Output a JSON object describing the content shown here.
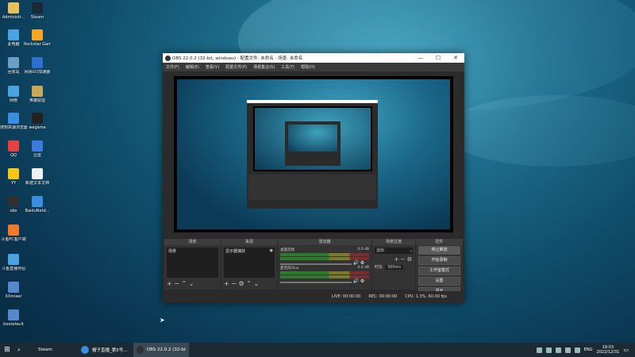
{
  "desktop": {
    "icons": [
      {
        "label": "Administr...",
        "color": "#e8c15a"
      },
      {
        "label": "Steam",
        "color": "#1b2838"
      },
      {
        "label": "此电脑",
        "color": "#4aa3e0"
      },
      {
        "label": "Rockstar Games...",
        "color": "#f5a623"
      },
      {
        "label": "回收站",
        "color": "#6aa0c8"
      },
      {
        "label": "网易UU加速器",
        "color": "#2f6fd0"
      },
      {
        "label": "网络",
        "color": "#4aa3e0"
      },
      {
        "label": "英雄联盟",
        "color": "#c8a85a"
      },
      {
        "label": "搜狗高速浏览器",
        "color": "#3b8de0"
      },
      {
        "label": "wegame",
        "color": "#222222"
      },
      {
        "label": "QQ",
        "color": "#e84040"
      },
      {
        "label": "迅雷",
        "color": "#3b7be0"
      },
      {
        "label": "YY",
        "color": "#f5c518"
      },
      {
        "label": "新建文本文档",
        "color": "#f0f0f0"
      },
      {
        "label": "obs",
        "color": "#303030"
      },
      {
        "label": "BaiduNetd...",
        "color": "#3b8de0"
      },
      {
        "label": "斗鱼PC客户端",
        "color": "#f07a2a"
      },
      {
        "label": "斗鱼直播伴侣",
        "color": "#4aa3e0"
      },
      {
        "label": "XXmixer",
        "color": "#5588cc"
      },
      {
        "label": "bootefault",
        "color": "#5588cc"
      }
    ]
  },
  "obs": {
    "title": "OBS 22.0.2 (32-bit, windows) - 配置文件: 未命名 - 场景: 未命名",
    "window_buttons": {
      "minimize": "—",
      "maximize": "☐",
      "close": "✕"
    },
    "menu": [
      "文件(F)",
      "编辑(E)",
      "查看(V)",
      "配置文件(P)",
      "场景集合(S)",
      "工具(T)",
      "帮助(H)"
    ],
    "docks": {
      "scenes": {
        "title": "场景",
        "items": [
          "场景"
        ]
      },
      "sources": {
        "title": "来源",
        "items": [
          "显示器捕获"
        ]
      },
      "mixer": {
        "title": "混音器",
        "channels": [
          {
            "name": "桌面音频",
            "level": "0.0 dB"
          },
          {
            "name": "麦克风/Aux",
            "level": "0.0 dB"
          }
        ]
      },
      "transitions": {
        "title": "场景过渡",
        "type": "淡出",
        "duration_label": "时长",
        "duration": "300ms"
      },
      "controls": {
        "title": "控件",
        "buttons": [
          "停止推流",
          "开始录制",
          "工作室模式",
          "设置",
          "退出"
        ]
      }
    },
    "status": {
      "live": "LIVE: 00:00:00",
      "rec": "REC: 00:00:00",
      "cpu": "CPU: 1.3%, 60.00 fps"
    }
  },
  "taskbar": {
    "apps": [
      {
        "label": "Steam",
        "color": "#1b2838"
      },
      {
        "label": "帽子直播_第5号...",
        "color": "#3b8de0"
      },
      {
        "label": "OBS 22.0.2 (32-bit...",
        "color": "#303030"
      }
    ],
    "tray": {
      "lang": "ENG",
      "time": "19:03",
      "date": "2022/12/31"
    }
  }
}
